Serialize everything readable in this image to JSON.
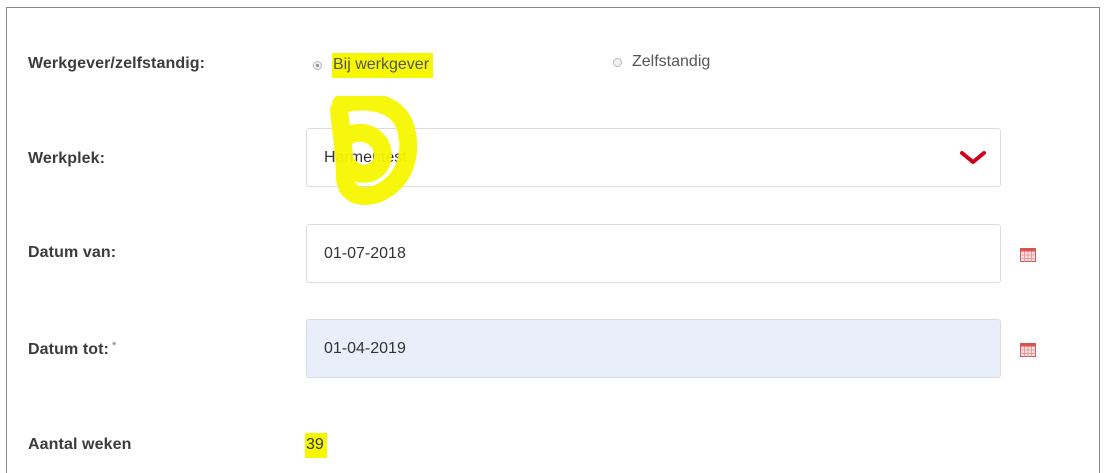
{
  "form": {
    "employer": {
      "label": "Werkgever/zelfstandig:",
      "options": [
        {
          "label": "Bij werkgever",
          "selected": true
        },
        {
          "label": "Zelfstandig",
          "selected": false
        }
      ]
    },
    "workplace": {
      "label": "Werkplek:",
      "value": "Harmentest",
      "icon": "chevron-down-icon"
    },
    "date_from": {
      "label": "Datum van:",
      "value": "01-07-2018",
      "icon": "calendar-icon"
    },
    "date_to": {
      "label": "Datum tot:",
      "required_mark": "*",
      "value": "01-04-2019",
      "icon": "calendar-icon"
    },
    "weeks": {
      "label": "Aantal weken",
      "value": "39"
    }
  },
  "colors": {
    "highlight": "#f7f700",
    "chevron": "#d0021b",
    "active_field": "#e8effa",
    "calendar": "#d9534f"
  }
}
